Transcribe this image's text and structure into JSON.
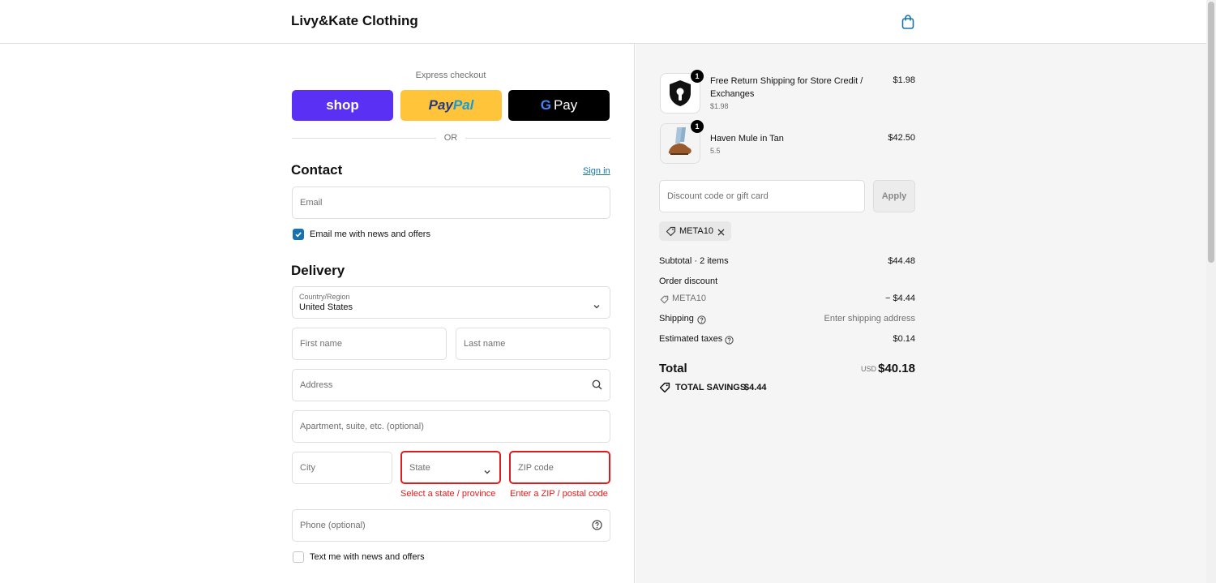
{
  "header": {
    "brand": "Livy&Kate Clothing",
    "cart_icon": "shopping-bag-icon"
  },
  "express": {
    "label": "Express checkout",
    "shop_label": "shop",
    "paypal_label_1": "Pay",
    "paypal_label_2": "Pal",
    "gpay_g": "G",
    "gpay_label": "Pay",
    "or_label": "OR"
  },
  "contact": {
    "title": "Contact",
    "sign_in": "Sign in",
    "email_placeholder": "Email",
    "news_label": "Email me with news and offers",
    "news_checked": true
  },
  "delivery": {
    "title": "Delivery",
    "country_label": "Country/Region",
    "country_value": "United States",
    "first_name": "First name",
    "last_name": "Last name",
    "address": "Address",
    "apartment": "Apartment, suite, etc. (optional)",
    "city": "City",
    "state": "State",
    "zip": "ZIP code",
    "state_error": "Select a state / province",
    "zip_error": "Enter a ZIP / postal code",
    "phone": "Phone (optional)",
    "text_label": "Text me with news and offers",
    "text_checked": false
  },
  "cart": {
    "items": [
      {
        "name": "Free Return Shipping for Store Credit / Exchanges",
        "sub": "$1.98",
        "price": "$1.98",
        "qty": "1",
        "icon": "lock-shield-icon"
      },
      {
        "name": "Haven Mule in Tan",
        "sub": "5.5",
        "price": "$42.50",
        "qty": "1",
        "icon": "shoe-image"
      }
    ],
    "discount_placeholder": "Discount code or gift card",
    "apply": "Apply",
    "applied_code": "META10"
  },
  "summary": {
    "subtotal_label": "Subtotal · 2 items",
    "subtotal_value": "$44.48",
    "order_discount_label": "Order discount",
    "discount_code": "META10",
    "discount_value": "− $4.44",
    "shipping_label": "Shipping",
    "shipping_value": "Enter shipping address",
    "taxes_label": "Estimated taxes",
    "taxes_value": "$0.14",
    "total_label": "Total",
    "currency": "USD",
    "total_value": "$40.18",
    "savings_label": "TOTAL SAVINGS",
    "savings_value": "$4.44"
  },
  "colors": {
    "accent": "#1773b0",
    "error": "#dd1d1d",
    "shop": "#5a31f4",
    "paypal": "#ffc439"
  }
}
